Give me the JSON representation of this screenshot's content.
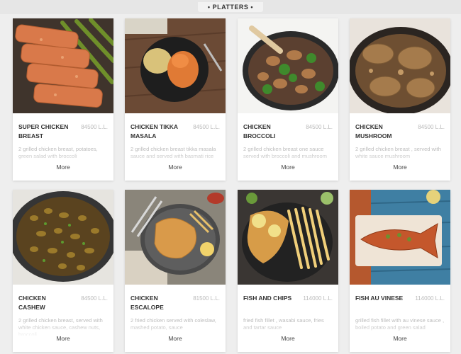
{
  "header": {
    "title": "• PLATTERS •"
  },
  "items": [
    {
      "name": "SUPER CHICKEN BREAST",
      "price": "84500 L.L.",
      "description": "2 grilled chicken breast, potatoes, green salad with broccoli",
      "more_label": "More"
    },
    {
      "name": "CHICKEN TIKKA MASALA",
      "price": "84500 L.L.",
      "description": "2 grilled chicken breast tikka masala sauce and served with basmati rice",
      "more_label": "More"
    },
    {
      "name": "CHICKEN BROCCOLI",
      "price": "84500 L.L.",
      "description": "2 grilled chicken breast one sauce served with broccoli and mushroom",
      "more_label": "More"
    },
    {
      "name": "CHICKEN MUSHROOM",
      "price": "84500 L.L.",
      "description": "2 grilled chicken breast , served with white sauce mushroom",
      "more_label": "More"
    },
    {
      "name": "CHICKEN CASHEW",
      "price": "84500 L.L.",
      "description": "2 grilled chicken breast, served with white chicken sauce, cashew nuts, broccoli",
      "more_label": "More"
    },
    {
      "name": "CHICKEN ESCALOPE",
      "price": "81500 L.L.",
      "description": "2 fried chicken served with coleslaw, mashed potato, sauce",
      "more_label": "More"
    },
    {
      "name": "FISH AND CHIPS",
      "price": "114000 L.L.",
      "description": "fried fish fillet , wasabi sauce, fries and tartar sauce",
      "more_label": "More"
    },
    {
      "name": "FISH AU VINESE",
      "price": "114000 L.L.",
      "description": "grilled fish fillet with au vinese sauce , boiled potato and green salad",
      "more_label": "More"
    }
  ]
}
